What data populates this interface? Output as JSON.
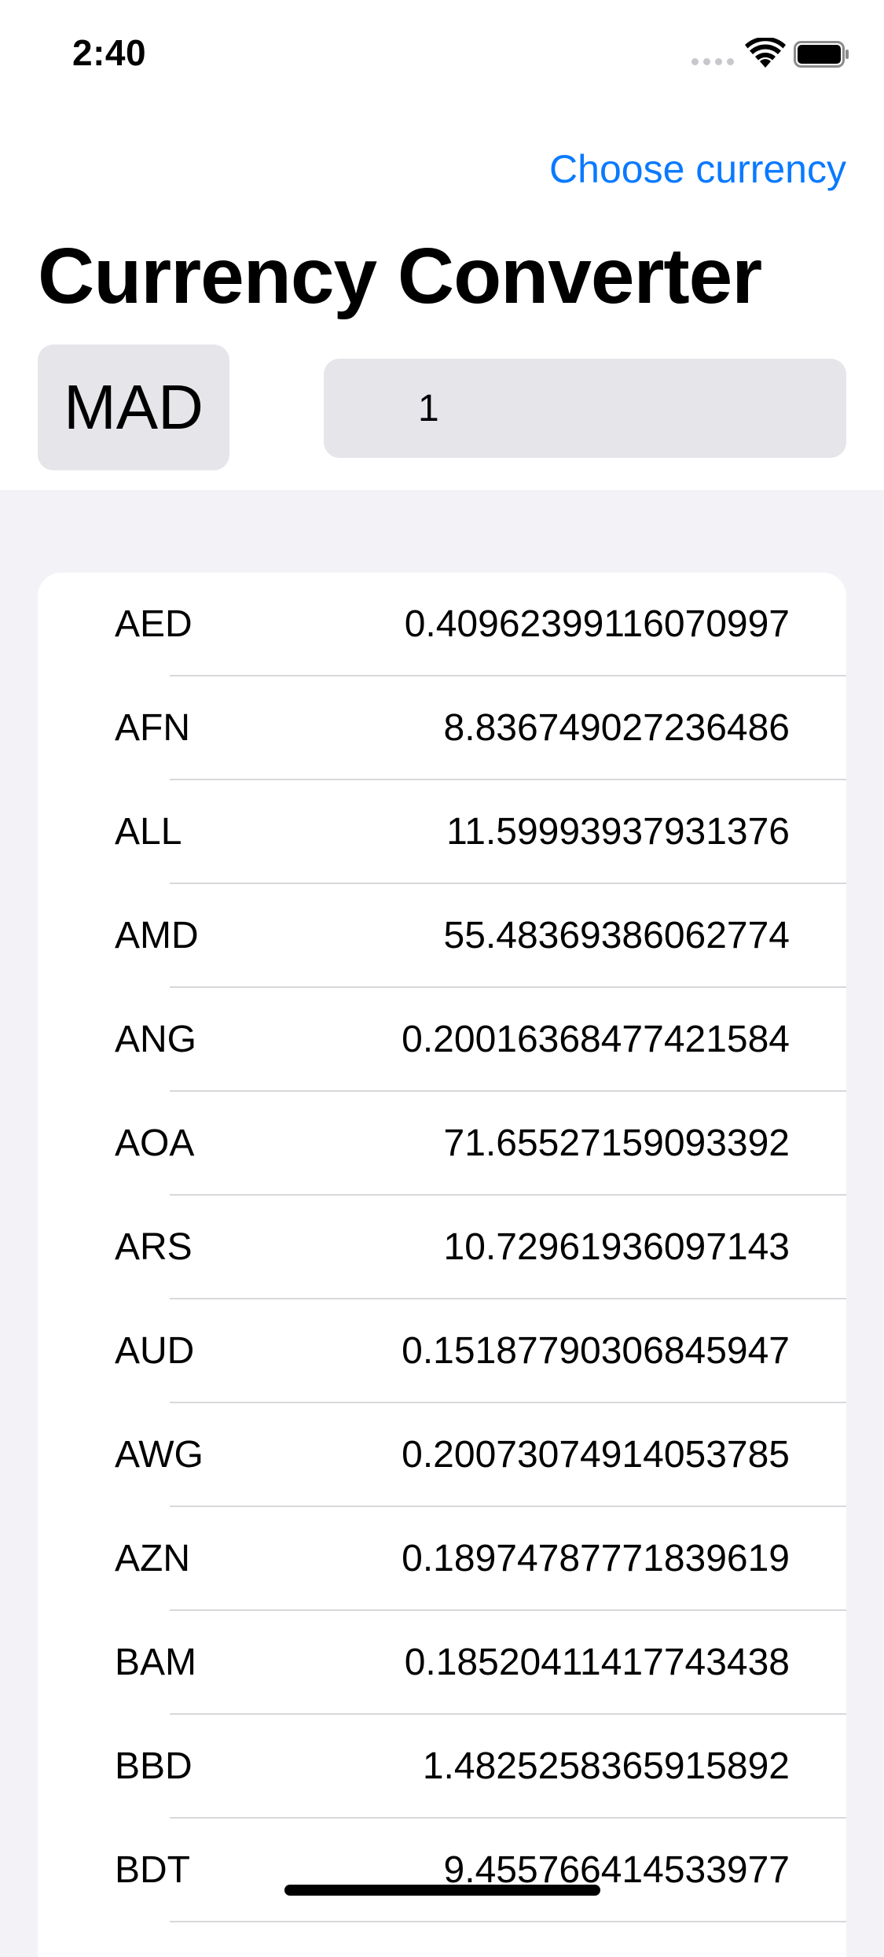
{
  "status_bar": {
    "time": "2:40",
    "icons": [
      "cellular-signal-icon",
      "wifi-icon",
      "battery-icon"
    ]
  },
  "nav": {
    "choose_currency": "Choose currency"
  },
  "title": "Currency Converter",
  "selected_currency": "MAD",
  "amount": "1",
  "rates": [
    {
      "code": "AED",
      "value": "0.40962399116070997"
    },
    {
      "code": "AFN",
      "value": "8.836749027236486"
    },
    {
      "code": "ALL",
      "value": "11.59993937931376"
    },
    {
      "code": "AMD",
      "value": "55.48369386062774"
    },
    {
      "code": "ANG",
      "value": "0.20016368477421584"
    },
    {
      "code": "AOA",
      "value": "71.65527159093392"
    },
    {
      "code": "ARS",
      "value": "10.72961936097143"
    },
    {
      "code": "AUD",
      "value": "0.15187790306845947"
    },
    {
      "code": "AWG",
      "value": "0.20073074914053785"
    },
    {
      "code": "AZN",
      "value": "0.18974787771839619"
    },
    {
      "code": "BAM",
      "value": "0.18520411417743438"
    },
    {
      "code": "BBD",
      "value": "1.4825258365915892"
    },
    {
      "code": "BDT",
      "value": "9.455766414533977"
    }
  ],
  "colors": {
    "accent": "#0A7AFF",
    "background": "#F2F2F7",
    "field": "#E5E5EA"
  }
}
